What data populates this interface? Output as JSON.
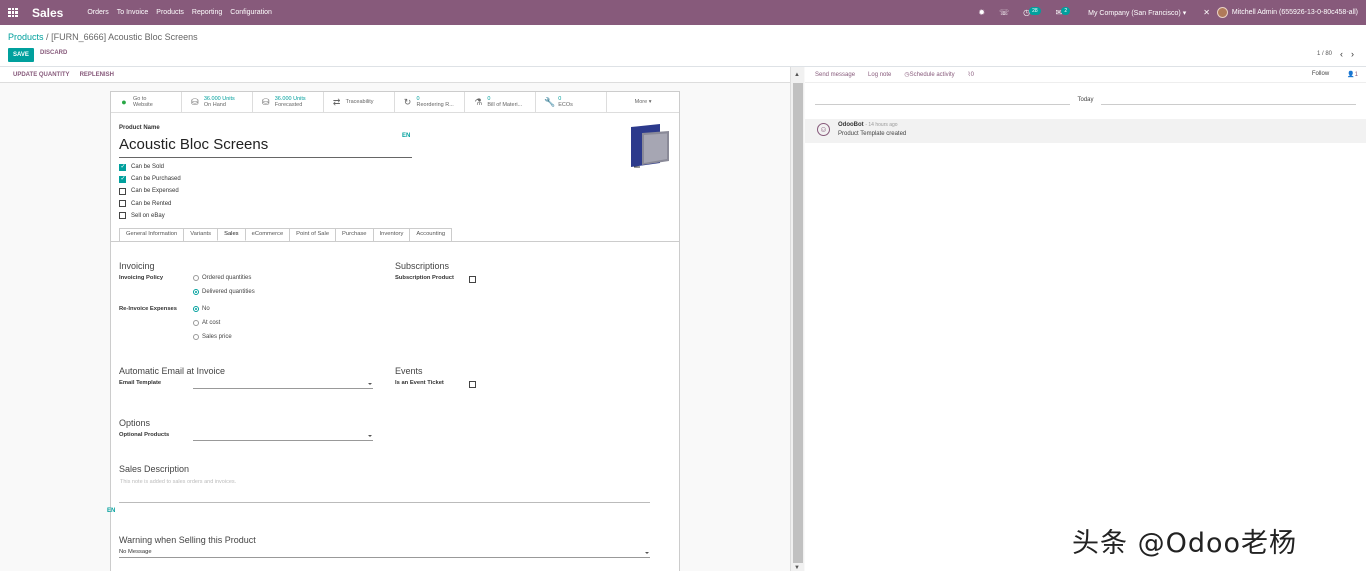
{
  "navbar": {
    "app_title": "Sales",
    "menu": [
      "Orders",
      "To Invoice",
      "Products",
      "Reporting",
      "Configuration"
    ],
    "activity_badge": "28",
    "messages_badge": "2",
    "company": "My Company (San Francisco)",
    "user": "Mitchell Admin (655926-13-0-80c458-all)",
    "icons": [
      "apps-grid-icon",
      "bug-icon",
      "phone-icon",
      "activity-clock-icon",
      "chat-bubble-icon",
      "close-icon"
    ]
  },
  "control_panel": {
    "breadcrumb_link": "Products",
    "breadcrumb_sep": "/",
    "breadcrumb_current": "[FURN_6666] Acoustic Bloc Screens",
    "save": "SAVE",
    "discard": "DISCARD",
    "pager": "1 / 80",
    "prev": "‹",
    "next": "›"
  },
  "action_bar": {
    "update_quantity": "UPDATE QUANTITY",
    "replenish": "REPLENISH"
  },
  "smart_buttons": [
    {
      "icon": "globe-icon",
      "line1": "Go to",
      "line2": "Website"
    },
    {
      "icon": "cubes-icon",
      "line1": "36.000 Units",
      "line2": "On Hand"
    },
    {
      "icon": "cubes-icon",
      "line1": "36.000 Units",
      "line2": "Forecasted"
    },
    {
      "icon": "arrows-icon",
      "line1": "Traceability",
      "line2": ""
    },
    {
      "icon": "refresh-icon",
      "line1": "0",
      "line2": "Reordering R..."
    },
    {
      "icon": "flask-icon",
      "line1": "0",
      "line2": "Bill of Materi..."
    },
    {
      "icon": "wrench-icon",
      "line1": "0",
      "line2": "ECOs"
    },
    {
      "icon": "",
      "line1": "More",
      "line2": ""
    }
  ],
  "product": {
    "name_label": "Product Name",
    "name": "Acoustic Bloc Screens",
    "lang": "EN",
    "checkboxes": [
      {
        "label": "Can be Sold",
        "checked": true
      },
      {
        "label": "Can be Purchased",
        "checked": true
      },
      {
        "label": "Can be Expensed",
        "checked": false
      },
      {
        "label": "Can be Rented",
        "checked": false
      },
      {
        "label": "Sell on eBay",
        "checked": false
      }
    ]
  },
  "tabs": [
    "General Information",
    "Variants",
    "Sales",
    "eCommerce",
    "Point of Sale",
    "Purchase",
    "Inventory",
    "Accounting"
  ],
  "active_tab": "Sales",
  "sales_tab": {
    "invoicing_title": "Invoicing",
    "invoicing_policy_label": "Invoicing Policy",
    "invoicing_policy_options": [
      "Ordered quantities",
      "Delivered quantities"
    ],
    "invoicing_policy_selected": "Delivered quantities",
    "reinvoice_label": "Re-Invoice Expenses",
    "reinvoice_options": [
      "No",
      "At cost",
      "Sales price"
    ],
    "reinvoice_selected": "No",
    "subscriptions_title": "Subscriptions",
    "subscription_product_label": "Subscription Product",
    "auto_email_title": "Automatic Email at Invoice",
    "email_template_label": "Email Template",
    "events_title": "Events",
    "event_ticket_label": "Is an Event Ticket",
    "options_title": "Options",
    "optional_products_label": "Optional Products",
    "sales_desc_title": "Sales Description",
    "sales_desc_placeholder": "This note is added to sales orders and invoices.",
    "desc_lang": "EN",
    "warning_title": "Warning when Selling this Product",
    "warning_value": "No Message"
  },
  "chatter": {
    "send_message": "Send message",
    "log_note": "Log note",
    "schedule_activity": "Schedule activity",
    "attachments": "0",
    "follow": "Follow",
    "followers": "1",
    "today": "Today",
    "message": {
      "author": "OdooBot",
      "time": "- 14 hours ago",
      "body": "Product Template created"
    }
  },
  "watermark": "头条 @Odoo老杨"
}
